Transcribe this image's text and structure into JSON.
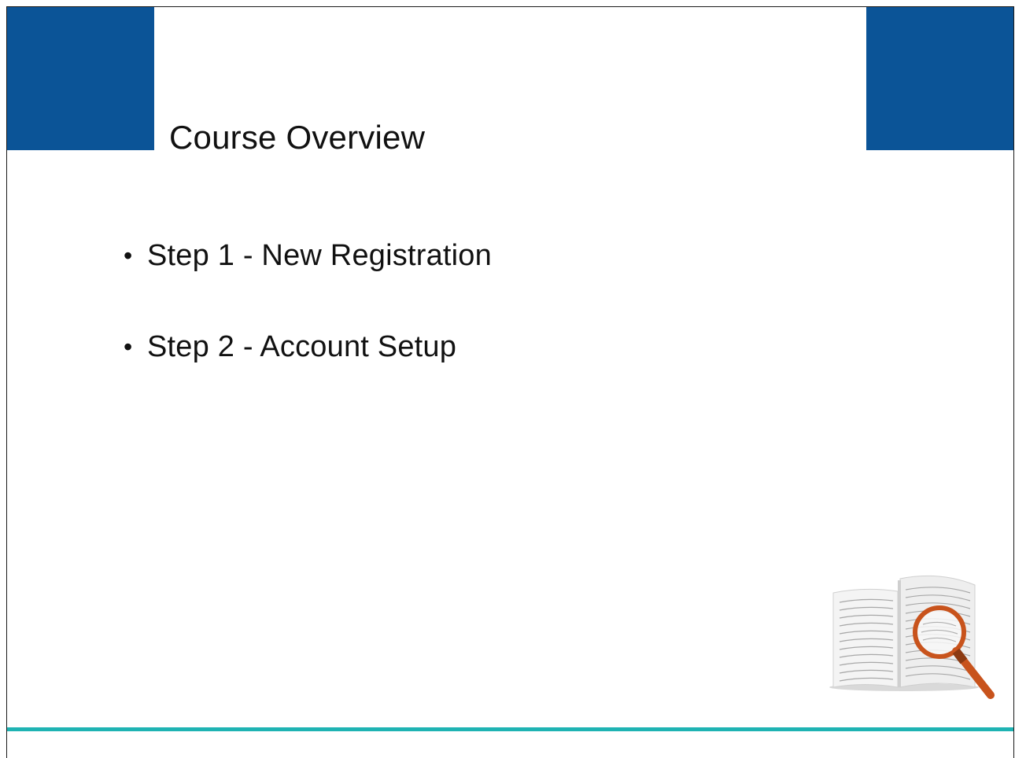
{
  "slide": {
    "title": "Course Overview",
    "bullets": [
      {
        "bullet": "•",
        "text": "Step 1 - New Registration"
      },
      {
        "bullet": "•",
        "text": "Step 2 - Account Setup"
      }
    ],
    "illustration_icon": "book-magnifier-icon"
  },
  "colors": {
    "corner_blocks": "#0b5497",
    "footer_line": "#1fb3b3",
    "text": "#111111",
    "magnifier": "#c8531c"
  }
}
